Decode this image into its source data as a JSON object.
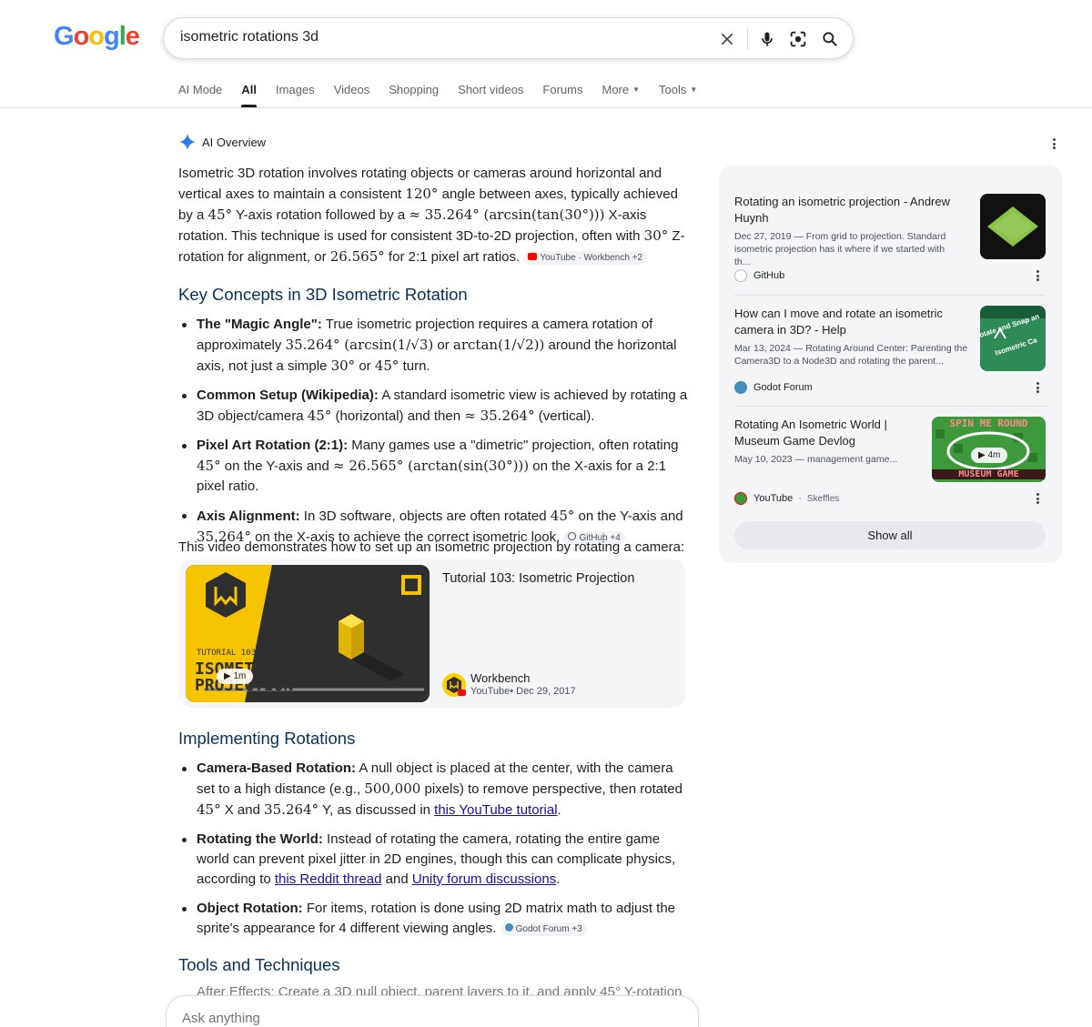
{
  "logo": {
    "letters": [
      "G",
      "o",
      "o",
      "g",
      "l",
      "e"
    ],
    "colors": [
      "#4285F4",
      "#EA4335",
      "#FBBC05",
      "#4285F4",
      "#34A853",
      "#EA4335"
    ]
  },
  "search": {
    "query": "isometric rotations 3d"
  },
  "tabs": [
    {
      "label": "AI Mode"
    },
    {
      "label": "All",
      "active": true
    },
    {
      "label": "Images"
    },
    {
      "label": "Videos"
    },
    {
      "label": "Shopping"
    },
    {
      "label": "Short videos"
    },
    {
      "label": "Forums"
    },
    {
      "label": "More",
      "dropdown": true
    },
    {
      "label": "Tools",
      "dropdown": true
    }
  ],
  "overview": {
    "title": "AI Overview",
    "intro": {
      "p1": "Isometric 3D rotation involves rotating objects or cameras around horizontal and vertical axes to maintain a consistent ",
      "m1": "120°",
      "p2": " angle between axes, typically achieved by a ",
      "m2": "45°",
      "p3": " Y-axis rotation followed by a ",
      "m3": "≈ 35.264° (arcsin(tan(30°)))",
      "p4": " X-axis rotation. This technique is used for consistent 3D-to-2D projection, often with ",
      "m4": "30°",
      "p5": " Z-rotation for alignment, or ",
      "m5": "26.565°",
      "p6": " for 2:1 pixel art ratios. ",
      "chip": "YouTube · Workbench +2"
    },
    "key_concepts_heading": "Key Concepts in 3D Isometric Rotation",
    "key_concepts": [
      {
        "bold": "The \"Magic Angle\":",
        "t1": " True isometric projection requires a camera rotation of approximately ",
        "m1": "35.264° (arcsin(1/√3)",
        "t2": " or ",
        "m2": "arctan(1/√2))",
        "t3": " around the horizontal axis, not just a simple ",
        "m3": "30°",
        "t4": " or ",
        "m4": "45°",
        "t5": " turn."
      },
      {
        "bold": "Common Setup (Wikipedia):",
        "t1": " A standard isometric view is achieved by rotating a 3D object/camera ",
        "m1": "45°",
        "t2": " (horizontal) and then ",
        "m2": "≈ 35.264°",
        "t3": " (vertical)."
      },
      {
        "bold": "Pixel Art Rotation (2:1):",
        "t1": " Many games use a \"dimetric\" projection, often rotating ",
        "m1": "45°",
        "t2": " on the Y-axis and ",
        "m2": "≈ 26.565° (arctan(sin(30°)))",
        "t3": " on the X-axis for a 2:1 pixel ratio."
      },
      {
        "bold": "Axis Alignment:",
        "t1": " In 3D software, objects are often rotated ",
        "m1": "45°",
        "t2": " on the Y-axis and ",
        "m2": "35.264°",
        "t3": " on the X-axis to achieve the correct isometric look. ",
        "chip": "GitHub +4"
      }
    ],
    "video_intro": "This video demonstrates how to set up an isometric projection by rotating a camera:",
    "video": {
      "title": "Tutorial 103: Isometric Projection",
      "channel": "Workbench",
      "meta": "YouTube• Dec 29, 2017",
      "duration": "1m",
      "thumb_line1": "TUTORIAL 103:",
      "thumb_line2": "ISOMETRIC",
      "thumb_line3": "PROJECTION",
      "progress": 1.0
    },
    "implementing_heading": "Implementing Rotations",
    "implementing": [
      {
        "bold": "Camera-Based Rotation:",
        "t1": " A null object is placed at the center, with the camera set to a high distance (e.g., ",
        "m1": "500,000",
        "t2": " pixels) to remove perspective, then rotated ",
        "m2": "45°",
        "t3": " X and ",
        "m3": "35.264°",
        "t4": " Y, as discussed in ",
        "link1": "this YouTube tutorial",
        "t5": "."
      },
      {
        "bold": "Rotating the World:",
        "t1": " Instead of rotating the camera, rotating the entire game world can prevent pixel jitter in 2D engines, though this can complicate physics, according to ",
        "link1": "this Reddit thread",
        "t2": " and ",
        "link2": "Unity forum discussions",
        "t3": "."
      },
      {
        "bold": "Object Rotation:",
        "t1": " For items, rotation is done using 2D matrix math to adjust the sprite's appearance for 4 different viewing angles. ",
        "chip": "Godot Forum +3"
      }
    ],
    "tools_heading": "Tools and Techniques",
    "tools_partial": "After Effects: Create a 3D null object, parent layers to it, and apply 45° Y-rotation"
  },
  "sources": [
    {
      "title": "Rotating an isometric projection - Andrew Huynh",
      "snippet": "Dec 27, 2019 — From grid to projection. Standard isometric projection has it where if we started with th...",
      "site": "GitHub"
    },
    {
      "title": "How can I move and rotate an isometric camera in 3D? - Help",
      "snippet": "Mar 13, 2024 — Rotating Around Center: Parenting the Camera3D to a Node3D and rotating the parent...",
      "site": "Godot Forum",
      "thumb_text": "otate and Snap an Isometric Ca"
    },
    {
      "title": "Rotating An Isometric World | Museum Game Devlog",
      "snippet": "May 10, 2023 — management game...",
      "site": "YouTube",
      "site_extra": "Skeffles",
      "duration": "4m",
      "thumb_top": "SPIN ME ROUND",
      "thumb_bottom": "MUSEUM GAME"
    }
  ],
  "show_all": "Show all",
  "ask": {
    "placeholder": "Ask anything"
  }
}
